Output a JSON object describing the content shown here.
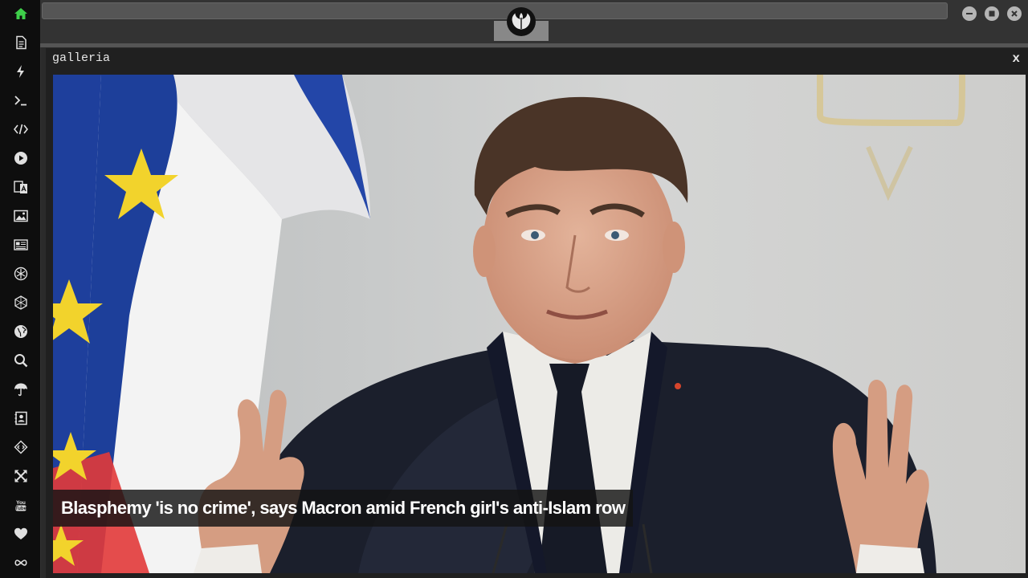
{
  "sidebar": {
    "items": [
      {
        "icon": "home-icon",
        "active": true
      },
      {
        "icon": "document-icon"
      },
      {
        "icon": "lightning-icon"
      },
      {
        "icon": "terminal-icon"
      },
      {
        "icon": "code-icon"
      },
      {
        "icon": "play-icon"
      },
      {
        "icon": "translate-icon"
      },
      {
        "icon": "image-icon"
      },
      {
        "icon": "newspaper-icon"
      },
      {
        "icon": "rebel-alliance-icon"
      },
      {
        "icon": "hexagon-grid-icon"
      },
      {
        "icon": "globe-icon"
      },
      {
        "icon": "search-icon"
      },
      {
        "icon": "umbrella-icon"
      },
      {
        "icon": "contacts-icon"
      },
      {
        "icon": "diamond-code-icon"
      },
      {
        "icon": "expand-icon"
      },
      {
        "icon": "youtube-icon",
        "label": "You Tube"
      },
      {
        "icon": "heart-icon"
      },
      {
        "icon": "infinity-cloud-icon"
      }
    ],
    "active_color": "#3ecf4a"
  },
  "window": {
    "logo": "rebel-alliance-icon",
    "controls": [
      "minimize-icon",
      "maximize-icon",
      "close-icon"
    ]
  },
  "panel": {
    "title": "galleria",
    "close_label": "x",
    "caption": "Blasphemy 'is no crime', says Macron amid French girl's anti-Islam row"
  },
  "colors": {
    "flag_blue": "#1d3f9a",
    "flag_white": "#f4f4f4",
    "flag_red": "#e23a3a",
    "eu_star": "#f2d32c"
  }
}
